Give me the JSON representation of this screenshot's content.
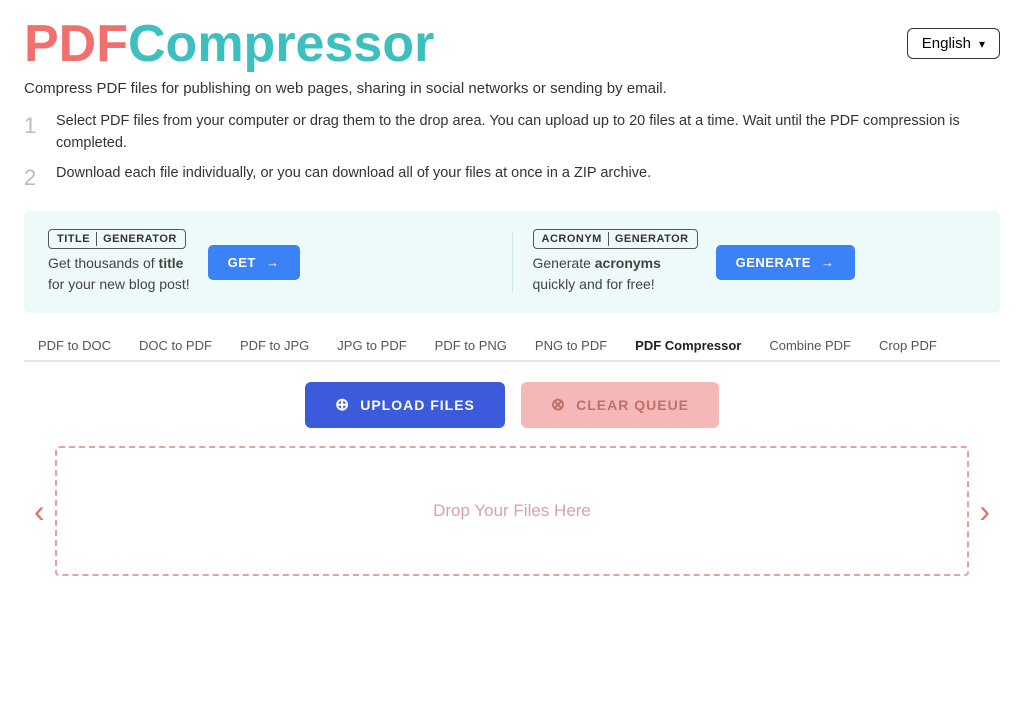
{
  "header": {
    "logo_pdf": "PDF",
    "logo_compressor": "Compressor",
    "lang_label": "English"
  },
  "subtitle": "Compress PDF files for publishing on web pages, sharing in social networks or sending by email.",
  "steps": [
    {
      "number": "1",
      "text": "Select PDF files from your computer or drag them to the drop area. You can upload up to 20 files at a time. Wait until the PDF compression is completed."
    },
    {
      "number": "2",
      "text": "Download each file individually, or you can download all of your files at once in a ZIP archive."
    }
  ],
  "ad": {
    "left": {
      "badge_part1": "TITLE",
      "badge_part2": "GENERATOR",
      "text_before": "Get thousands of ",
      "text_bold": "title",
      "text_after": "\nfor your new blog post!",
      "btn_label": "GET",
      "btn_arrow": "→"
    },
    "right": {
      "badge_part1": "ACRONYM",
      "badge_part2": "GENERATOR",
      "text_before": "Generate ",
      "text_bold": "acronyms",
      "text_after": "\nquickly and for free!",
      "btn_label": "GENERATE",
      "btn_arrow": "→"
    }
  },
  "nav_tabs": [
    {
      "label": "PDF to DOC",
      "active": false
    },
    {
      "label": "DOC to PDF",
      "active": false
    },
    {
      "label": "PDF to JPG",
      "active": false
    },
    {
      "label": "JPG to PDF",
      "active": false
    },
    {
      "label": "PDF to PNG",
      "active": false
    },
    {
      "label": "PNG to PDF",
      "active": false
    },
    {
      "label": "PDF Compressor",
      "active": true
    },
    {
      "label": "Combine PDF",
      "active": false
    },
    {
      "label": "Crop PDF",
      "active": false
    }
  ],
  "buttons": {
    "upload_label": "UPLOAD FILES",
    "clear_label": "CLEAR QUEUE"
  },
  "drop_area": {
    "placeholder": "Drop Your Files Here"
  },
  "nav_arrows": {
    "left": "‹",
    "right": "›"
  }
}
